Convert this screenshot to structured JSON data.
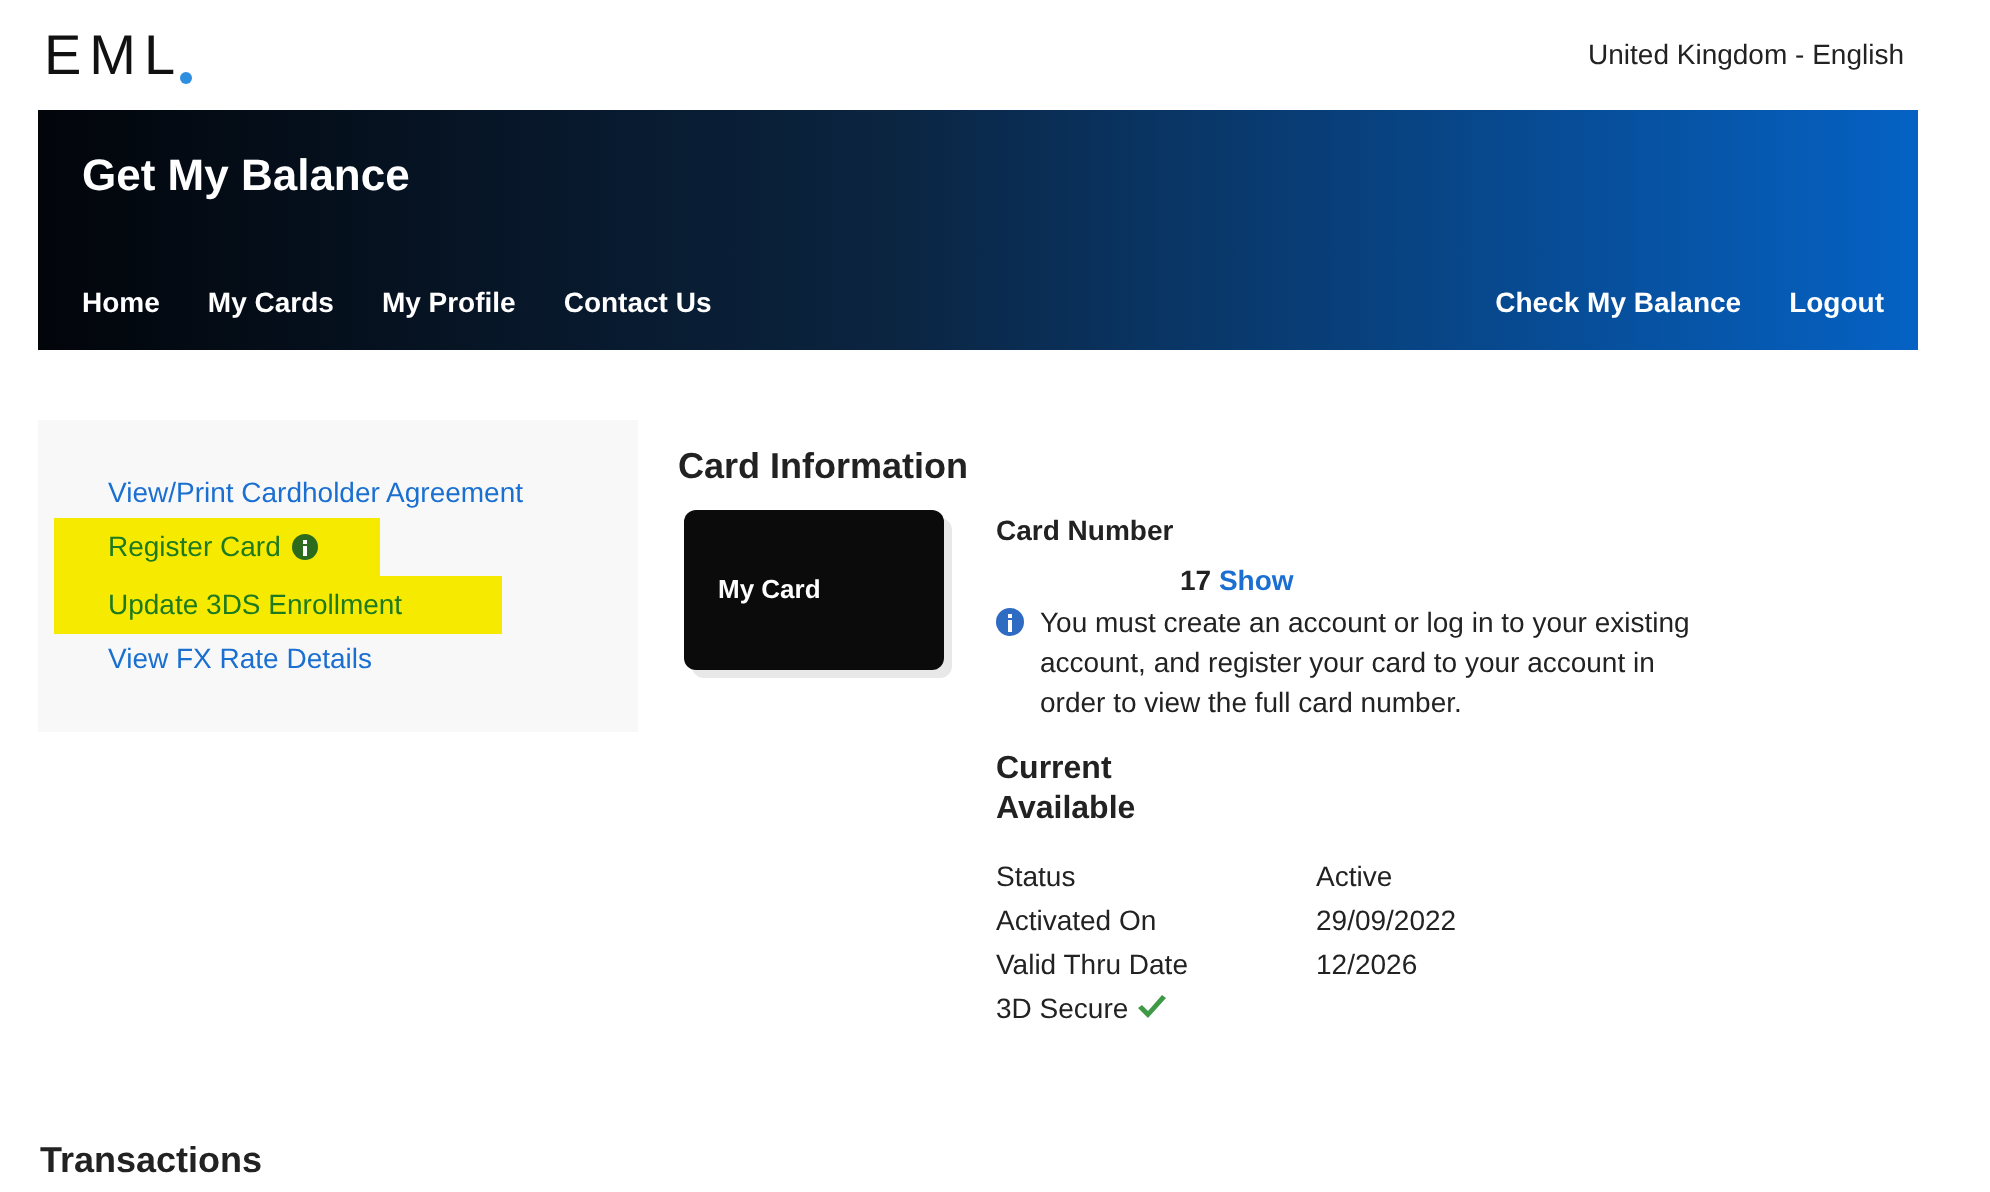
{
  "logo": {
    "text": "EML"
  },
  "locale": "United Kingdom - English",
  "header": {
    "title": "Get My Balance",
    "nav_left": [
      "Home",
      "My Cards",
      "My Profile",
      "Contact Us"
    ],
    "nav_right": [
      "Check My Balance",
      "Logout"
    ]
  },
  "sidebar": {
    "links": [
      {
        "label": "View/Print Cardholder Agreement",
        "highlighted": false,
        "info": false
      },
      {
        "label": "Register Card",
        "highlighted": true,
        "info": true
      },
      {
        "label": "Update 3DS Enrollment",
        "highlighted": true,
        "info": false
      },
      {
        "label": "View FX Rate Details",
        "highlighted": false,
        "info": false
      }
    ]
  },
  "card_info": {
    "heading": "Card Information",
    "card_label": "My Card",
    "number_label": "Card Number",
    "number_suffix": "17",
    "show_link": "Show",
    "notice": "You must create an account or log in to your existing account, and register your card to your account in order to view the full card number.",
    "balance_heading": "Current Available",
    "details": [
      {
        "label": "Status",
        "value": "Active"
      },
      {
        "label": "Activated On",
        "value": "29/09/2022"
      },
      {
        "label": "Valid Thru Date",
        "value": "12/2026"
      },
      {
        "label": "3D Secure",
        "secure": true
      }
    ]
  },
  "transactions": {
    "heading": "Transactions"
  }
}
